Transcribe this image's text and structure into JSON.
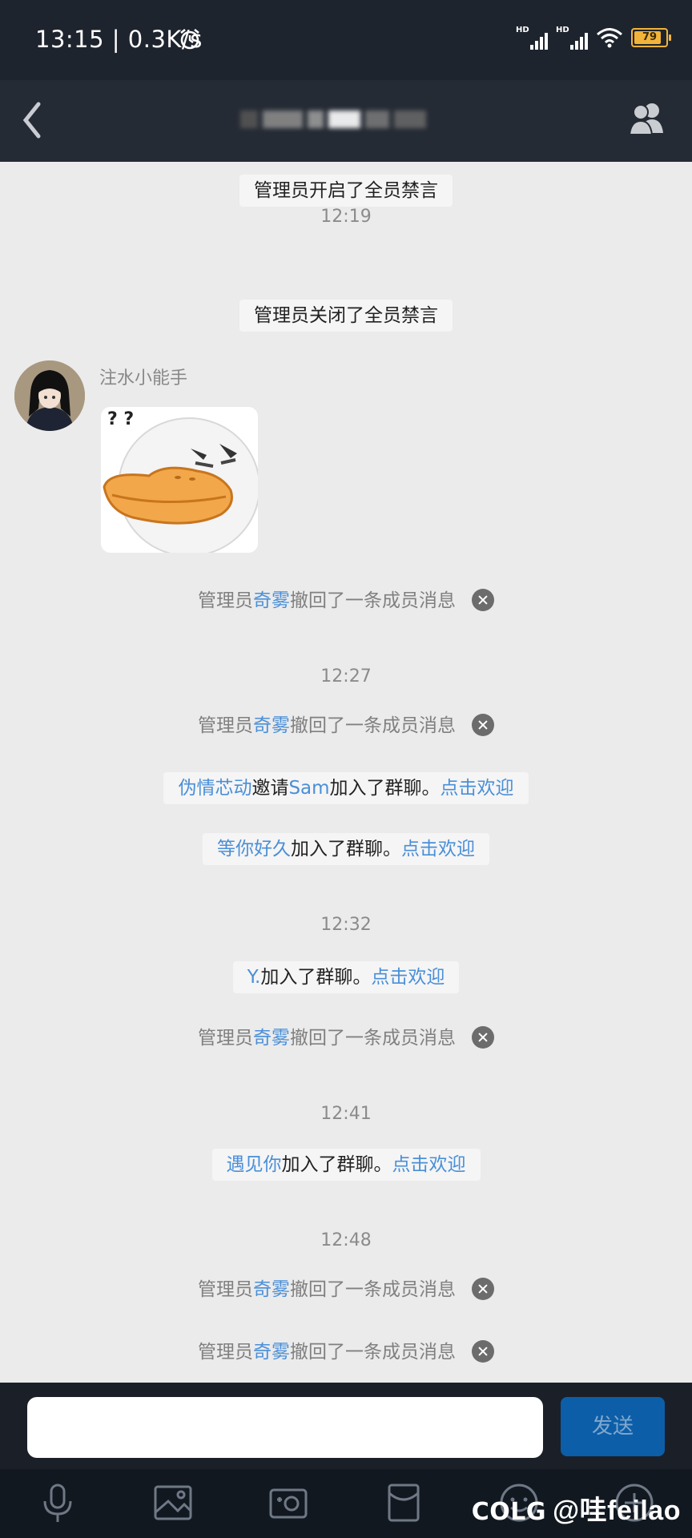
{
  "status": {
    "time": "13:15",
    "speed": "0.3K/s",
    "network_label": "HD",
    "battery": "79"
  },
  "header": {
    "back_icon": "chevron-left-icon",
    "members_icon": "group-members-icon"
  },
  "chat": {
    "messages": [
      {
        "type": "system",
        "text": "管理员开启了全员禁言"
      },
      {
        "type": "timestamp",
        "text": "12:19"
      },
      {
        "type": "system",
        "text": "管理员关闭了全员禁言"
      },
      {
        "type": "sticker",
        "sender": "注水小能手"
      },
      {
        "type": "recall",
        "prefix": "管理员",
        "name": "奇雾",
        "suffix": "撤回了一条成员消息"
      },
      {
        "type": "timestamp",
        "text": "12:27"
      },
      {
        "type": "recall",
        "prefix": "管理员",
        "name": "奇雾",
        "suffix": "撤回了一条成员消息"
      },
      {
        "type": "join",
        "inviter": "伪情芯动",
        "mid": "邀请",
        "user": "Sam",
        "text": "加入了群聊。",
        "action": "点击欢迎"
      },
      {
        "type": "join",
        "user": "等你好久",
        "text": "加入了群聊。",
        "action": "点击欢迎"
      },
      {
        "type": "timestamp",
        "text": "12:32"
      },
      {
        "type": "join",
        "user": "Y.",
        "text": "加入了群聊。",
        "action": "点击欢迎"
      },
      {
        "type": "recall",
        "prefix": "管理员",
        "name": "奇雾",
        "suffix": "撤回了一条成员消息"
      },
      {
        "type": "timestamp",
        "text": "12:41"
      },
      {
        "type": "join",
        "user": "遇见你",
        "text": "加入了群聊。",
        "action": "点击欢迎"
      },
      {
        "type": "timestamp",
        "text": "12:48"
      },
      {
        "type": "recall",
        "prefix": "管理员",
        "name": "奇雾",
        "suffix": "撤回了一条成员消息"
      },
      {
        "type": "recall",
        "prefix": "管理员",
        "name": "奇雾",
        "suffix": "撤回了一条成员消息"
      }
    ]
  },
  "input": {
    "value": "",
    "send_label": "发送"
  },
  "toolbar": {
    "icons": [
      "microphone-icon",
      "image-icon",
      "camera-icon",
      "red-packet-icon",
      "emoji-icon",
      "plus-icon"
    ]
  },
  "watermark": {
    "logo": "COLG",
    "text": "@哇feilao"
  }
}
